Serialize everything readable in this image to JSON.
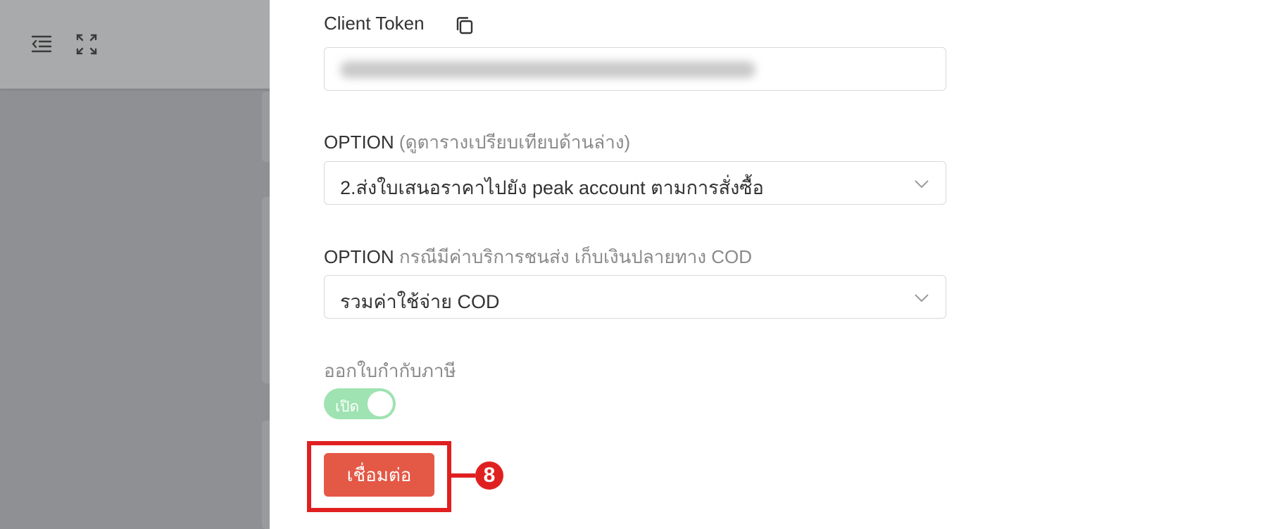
{
  "background": {
    "topbar_icons": [
      "menu-collapse-icon",
      "fullscreen-icon"
    ]
  },
  "form": {
    "client_token": {
      "label": "Client Token",
      "copy_icon": "copy-icon",
      "value_obscured": true
    },
    "option1": {
      "label": "OPTION",
      "note": "(ดูตารางเปรียบเทียบด้านล่าง)",
      "value": "2.ส่งใบเสนอราคาไปยัง peak account ตามการสั่งซื้อ"
    },
    "option2": {
      "label": "OPTION",
      "note": "กรณีมีค่าบริการชนส่ง เก็บเงินปลายทาง COD",
      "value": "รวมค่าใช้จ่าย COD"
    },
    "tax_invoice": {
      "label": "ออกใบกำกับภาษี",
      "toggle_text": "เปิด",
      "enabled": true
    },
    "connect_button": "เชื่อมต่อ"
  },
  "annotation": {
    "step_number": "8",
    "color": "#e02020"
  },
  "colors": {
    "primary_button": "#e45846",
    "toggle_on": "#9ee3b1",
    "overlay": "#8f9093"
  }
}
